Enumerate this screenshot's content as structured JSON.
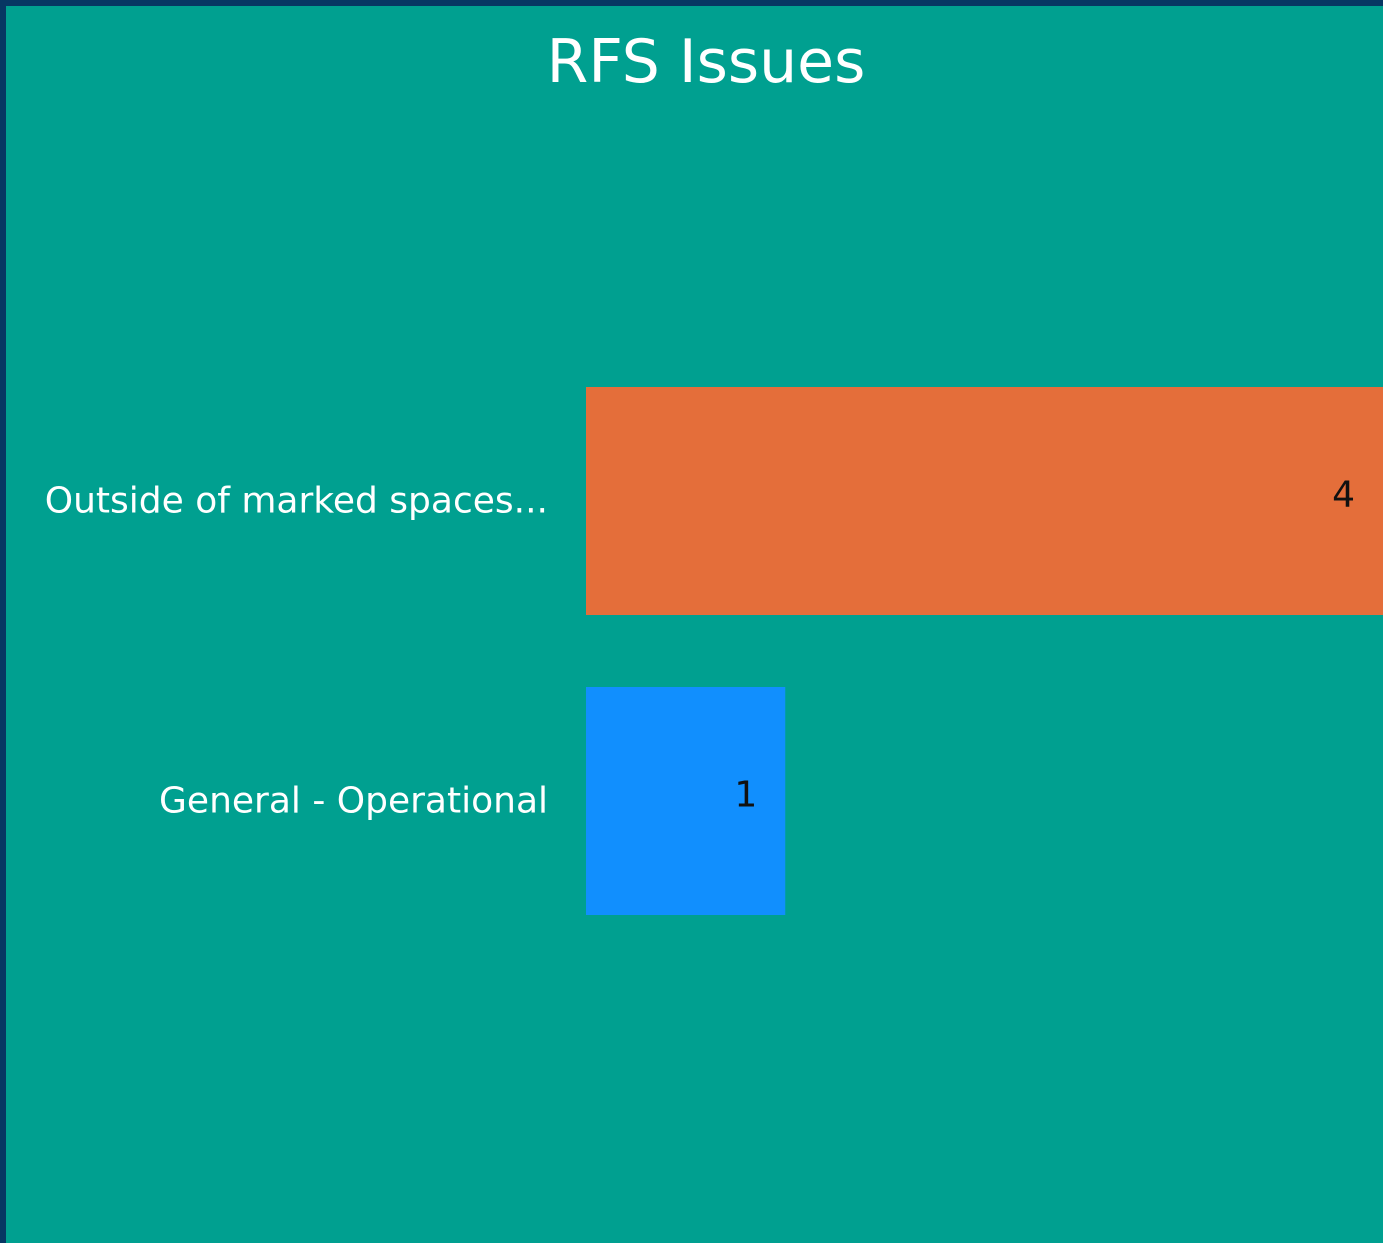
{
  "chart_data": {
    "type": "bar",
    "orientation": "horizontal",
    "title": "RFS Issues",
    "categories": [
      "Outside of marked spaces...",
      "General - Operational"
    ],
    "values": [
      4,
      1
    ],
    "colors": [
      "#e46e3a",
      "#118ffe"
    ],
    "xlim": [
      0,
      4
    ],
    "grid": false,
    "legend": "none"
  },
  "colors": {
    "background": "#00a090",
    "frame": "#073763",
    "text": "#ffffff",
    "value_text": "#111111"
  }
}
